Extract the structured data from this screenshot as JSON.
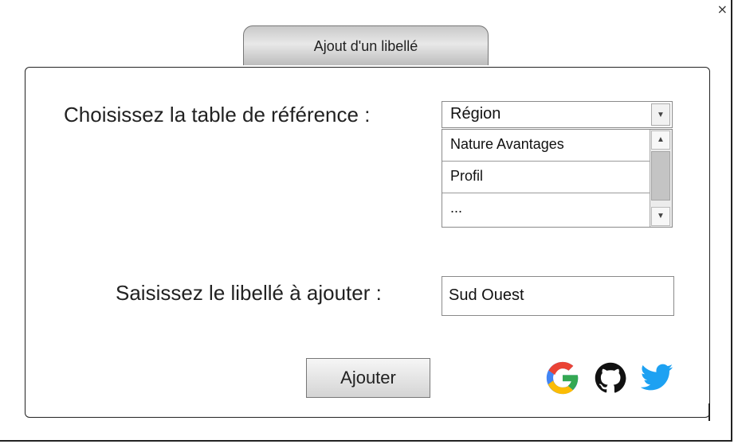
{
  "window": {
    "close_glyph": "×"
  },
  "dialog": {
    "tab_title": "Ajout d'un libellé",
    "table_label": "Choisissez la table de référence :",
    "libelle_label": "Saisissez le libellé à ajouter :",
    "select": {
      "selected_value": "Région",
      "arrow_icon": "chevron-down-icon",
      "options": [
        "Nature Avantages",
        "Profil",
        "..."
      ]
    },
    "libelle_input": {
      "value": "Sud Ouest"
    },
    "add_button_label": "Ajouter"
  },
  "social": {
    "icons": [
      "google-icon",
      "github-icon",
      "twitter-icon"
    ],
    "colors": {
      "google_blue": "#4285F4",
      "google_red": "#EA4335",
      "google_yellow": "#FBBC05",
      "google_green": "#34A853",
      "github": "#111111",
      "twitter": "#1DA1F2"
    }
  }
}
